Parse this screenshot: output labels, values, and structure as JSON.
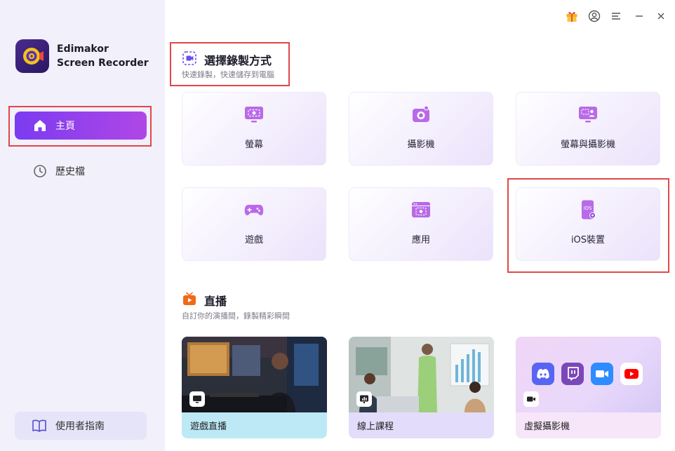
{
  "app": {
    "name_line1": "Edimakor",
    "name_line2": "Screen Recorder"
  },
  "sidebar": {
    "home_label": "主頁",
    "history_label": "歷史檔",
    "guide_label": "使用者指南"
  },
  "record": {
    "title": "選擇錄製方式",
    "subtitle": "快速錄製，快速儲存到電腦",
    "cards": [
      {
        "label": "螢幕",
        "icon": "screen-icon"
      },
      {
        "label": "攝影機",
        "icon": "camera-icon"
      },
      {
        "label": "螢幕與攝影機",
        "icon": "screen-camera-icon"
      },
      {
        "label": "遊戲",
        "icon": "gamepad-icon"
      },
      {
        "label": "應用",
        "icon": "app-window-icon"
      },
      {
        "label": "iOS裝置",
        "icon": "ios-device-icon"
      }
    ]
  },
  "live": {
    "title": "直播",
    "subtitle": "自訂你的演播間，錄製精彩瞬間",
    "cards": [
      {
        "label": "遊戲直播",
        "badge": "monitor-icon"
      },
      {
        "label": "線上課程",
        "badge": "presentation-icon"
      },
      {
        "label": "虛擬攝影機",
        "badge": "video-camera-icon"
      }
    ]
  },
  "colors": {
    "accent_start": "#7b3bf0",
    "accent_end": "#b047e6",
    "highlight_box": "#e04848",
    "live_icon": "#f06a1a"
  }
}
